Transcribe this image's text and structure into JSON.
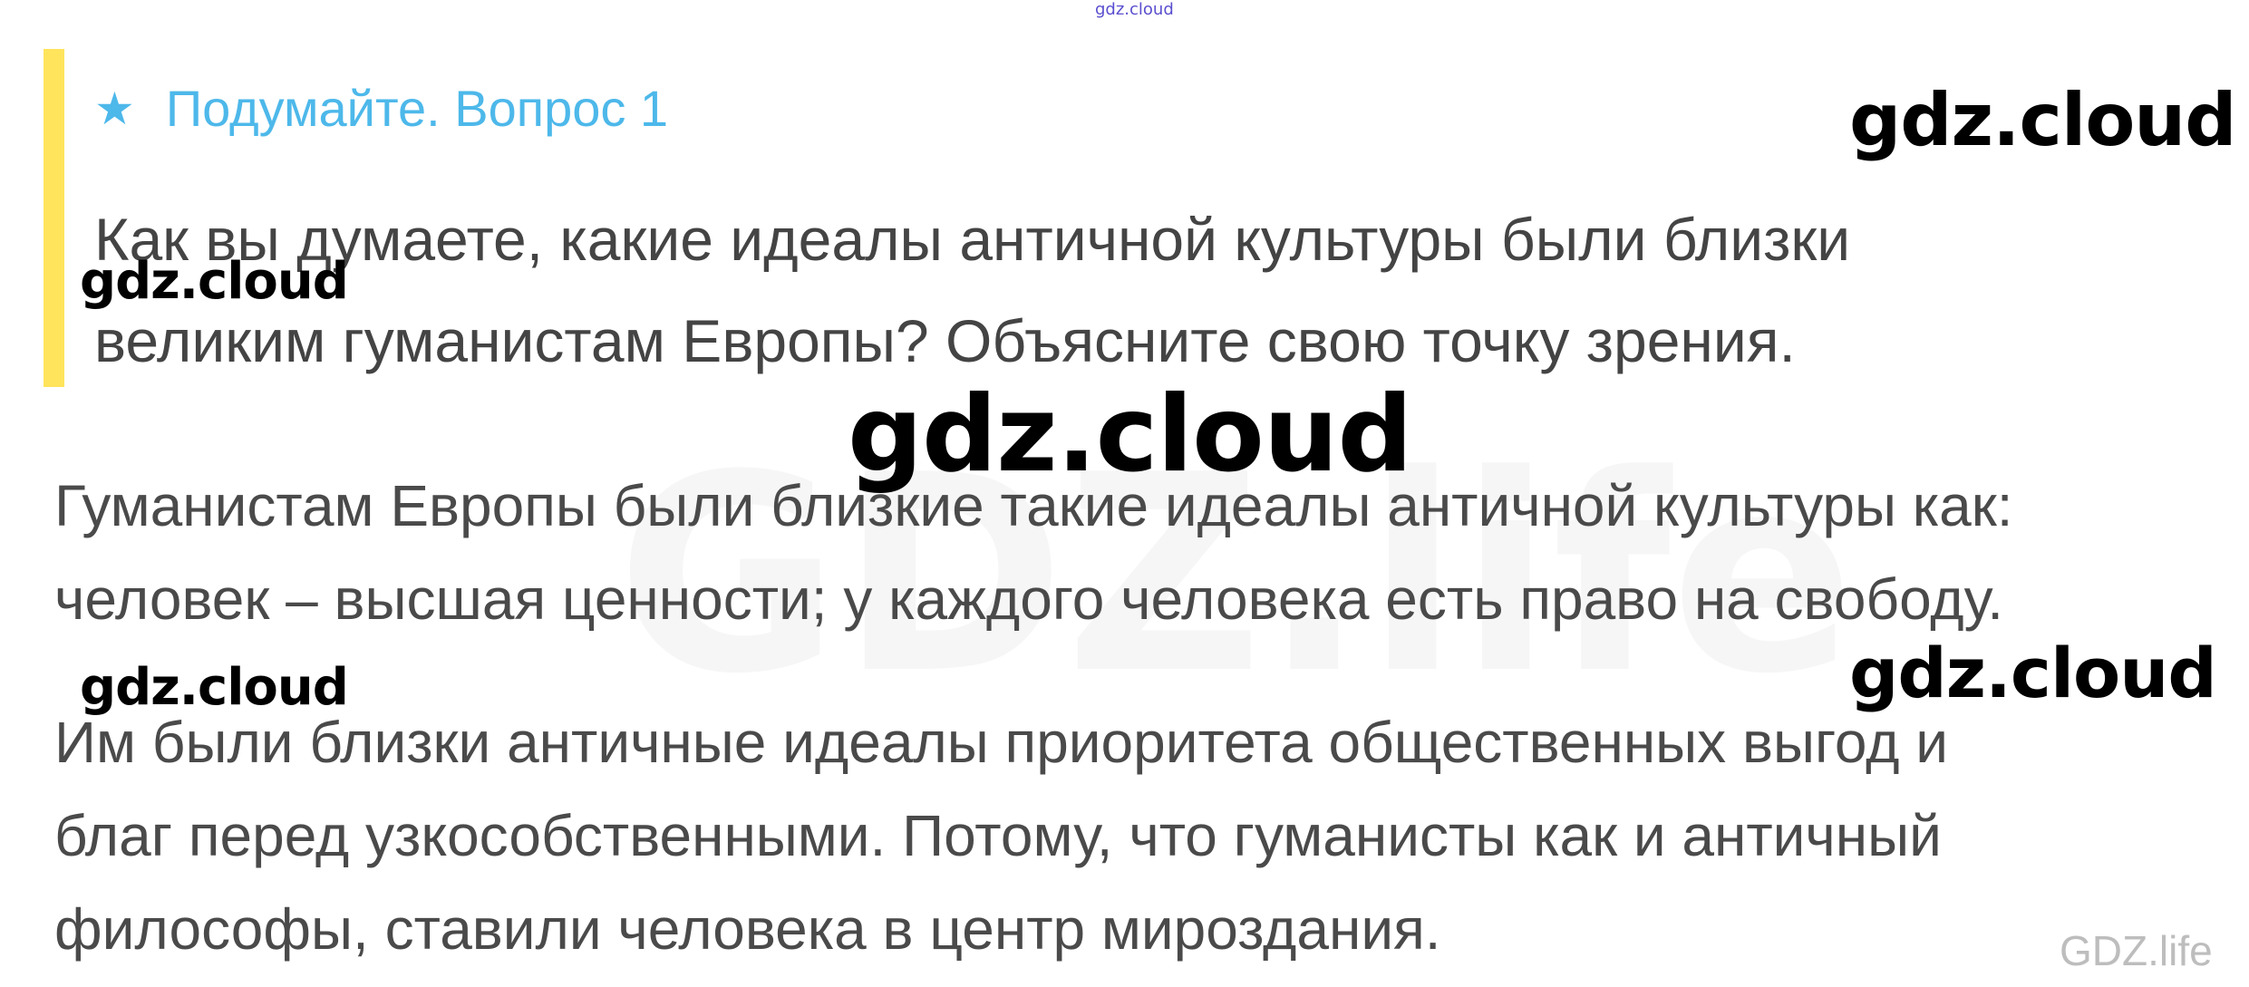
{
  "watermarks": {
    "top_tiny": "gdz.cloud",
    "top_right": "gdz.cloud",
    "left_1": "gdz.cloud",
    "center": "gdz.cloud",
    "left_2": "gdz.cloud",
    "right_2": "gdz.cloud",
    "faint_background": "GDZ.life"
  },
  "question": {
    "icon": "star-icon",
    "icon_glyph": "★",
    "title": "Подумайте. Вопрос 1",
    "lines": [
      "Как вы думаете, какие идеалы античной культуры были близки",
      "великим гуманистам Европы? Объясните свою точку зрения."
    ]
  },
  "answer": {
    "paragraphs": [
      [
        "Гуманистам Европы были близкие такие идеалы античной культуры как:",
        "человек – высшая ценности; у каждого человека есть право на свободу."
      ],
      [
        "Им были близки античные идеалы приоритета общественных выгод и",
        "благ перед узкособственными. Потому, что гуманисты как и античный",
        "философы, ставили человека в центр мироздания."
      ]
    ]
  },
  "footer": {
    "brand": "GDZ.life"
  },
  "colors": {
    "accent_bar": "#ffe45c",
    "title": "#4db8ea",
    "text": "#444444"
  }
}
